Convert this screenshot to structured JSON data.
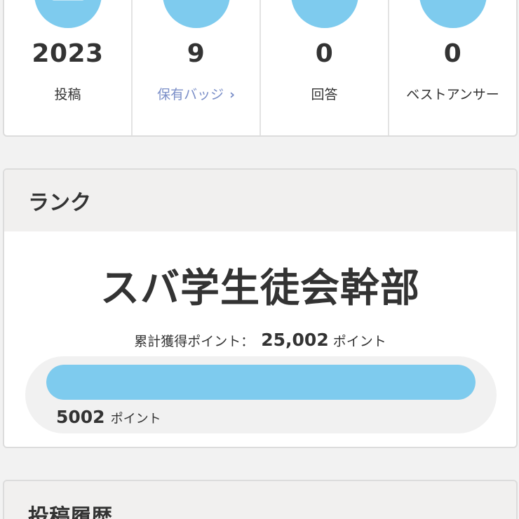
{
  "stats": [
    {
      "value": "2023",
      "label": "投稿",
      "icon": "document-icon"
    },
    {
      "value": "9",
      "label": "保有バッジ",
      "icon": "badge-icon",
      "link": true
    },
    {
      "value": "0",
      "label": "回答",
      "icon": "pencil-icon"
    },
    {
      "value": "0",
      "label": "ベストアンサー",
      "icon": "crown-icon"
    }
  ],
  "rank": {
    "header": "ランク",
    "name": "スバ学生徒会幹部",
    "total_label": "累計獲得ポイント：",
    "total_value": "25,002",
    "total_unit": "ポイント",
    "progress_value": "5002",
    "progress_unit": "ポイント",
    "progress_fraction": 1.0
  },
  "history": {
    "header": "投稿履歴"
  },
  "colors": {
    "accent": "#7ecbee",
    "link": "#7b8fc8",
    "text": "#333333",
    "header_bg": "#f1f0ef"
  }
}
